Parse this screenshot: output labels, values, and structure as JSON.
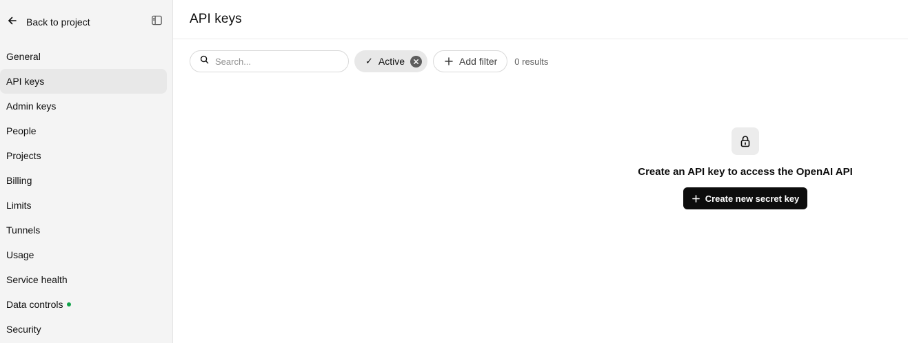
{
  "sidebar": {
    "back_label": "Back to project",
    "items": [
      {
        "label": "General"
      },
      {
        "label": "API keys"
      },
      {
        "label": "Admin keys"
      },
      {
        "label": "People"
      },
      {
        "label": "Projects"
      },
      {
        "label": "Billing"
      },
      {
        "label": "Limits"
      },
      {
        "label": "Tunnels"
      },
      {
        "label": "Usage"
      },
      {
        "label": "Service health"
      },
      {
        "label": "Data controls"
      },
      {
        "label": "Security"
      }
    ],
    "active_item": "API keys",
    "status_dot_color": "#10a34a"
  },
  "header": {
    "title": "API keys"
  },
  "toolbar": {
    "search_placeholder": "Search...",
    "active_filter_label": "Active",
    "add_filter_label": "Add filter",
    "results_text": "0 results"
  },
  "empty_state": {
    "title": "Create an API key to access the OpenAI API",
    "button_label": "Create new secret key"
  },
  "icons": {
    "back": "arrow-left-icon",
    "panel": "sidebar-toggle-icon",
    "search": "search-icon",
    "check": "check-icon",
    "clear": "close-icon",
    "add": "plus-icon",
    "lock": "lock-icon"
  }
}
